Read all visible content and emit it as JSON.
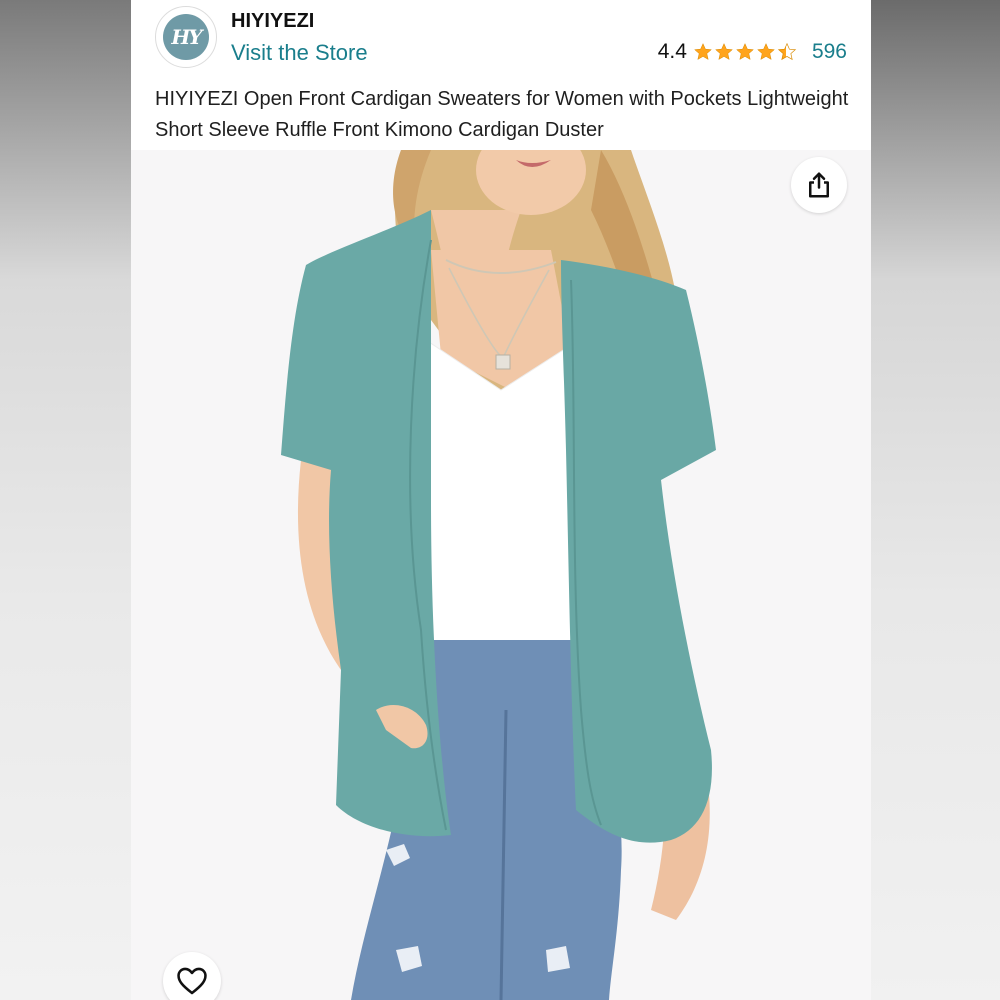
{
  "store": {
    "logo_text": "HY",
    "brand_name": "HIYIYEZI",
    "visit_link": "Visit the Store"
  },
  "rating": {
    "value": "4.4",
    "stars": 4.4,
    "review_count": "596"
  },
  "product": {
    "title": "HIYIYEZI Open Front Cardigan Sweaters for Women with Pockets Lightweight Short Sleeve Ruffle Front Kimono Cardigan Duster",
    "image_description_icon": "product-photo"
  },
  "actions": {
    "share_icon": "share-icon",
    "favorite_icon": "heart-icon"
  },
  "colors": {
    "link": "#1a7e8c",
    "star": "#ffa41c",
    "cardigan": "#6aa9a6",
    "denim": "#6f8fb6"
  }
}
